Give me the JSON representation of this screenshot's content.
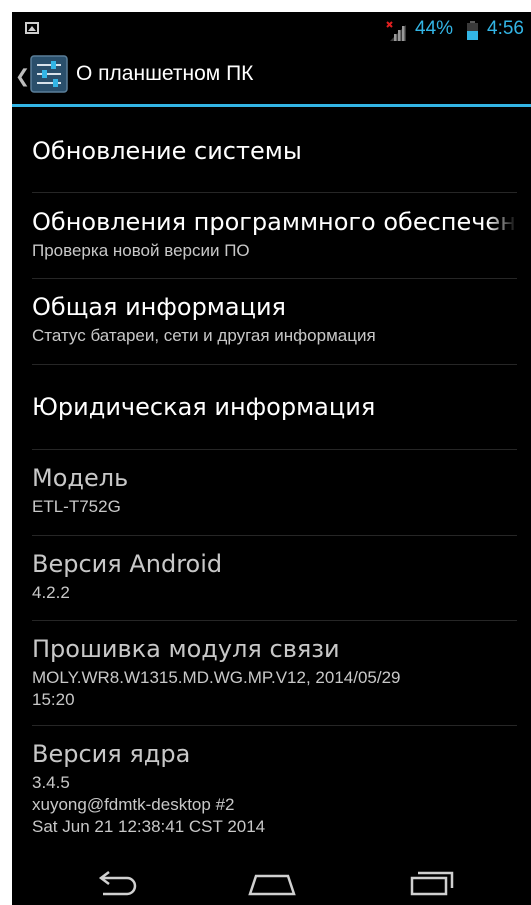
{
  "status_bar": {
    "battery_percent": "44%",
    "time": "4:56",
    "accent_color": "#33b5e5"
  },
  "action_bar": {
    "title": "О планшетном ПК",
    "up_glyph": "❮",
    "icon": "settings-sliders-icon"
  },
  "items": [
    {
      "title": "Обновление системы",
      "subtitle": ""
    },
    {
      "title": "Обновления программного обеспечения",
      "subtitle": "Проверка новой версии ПО"
    },
    {
      "title": "Общая информация",
      "subtitle": "Статус батареи, сети и другая информация"
    },
    {
      "title": "Юридическая информация",
      "subtitle": ""
    },
    {
      "title": "Модель",
      "subtitle": "ETL-T752G"
    },
    {
      "title": "Версия Android",
      "subtitle": "4.2.2"
    },
    {
      "title": "Прошивка модуля связи",
      "subtitle": "MOLY.WR8.W1315.MD.WG.MP.V12, 2014/05/29\n15:20"
    },
    {
      "title": "Версия ядра",
      "subtitle": "3.4.5\nxuyong@fdmtk-desktop #2\nSat Jun 21 12:38:41 CST 2014"
    }
  ],
  "nav": {
    "back": "back-icon",
    "home": "home-icon",
    "recents": "recent-apps-icon"
  }
}
